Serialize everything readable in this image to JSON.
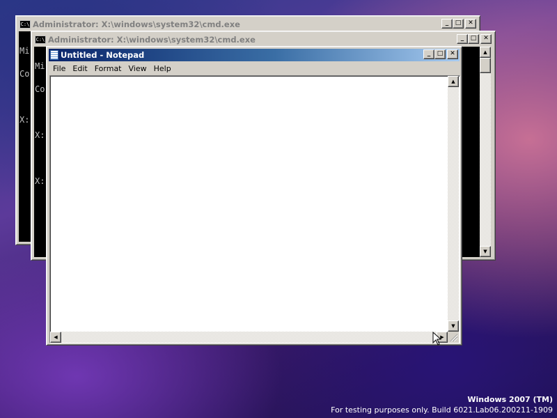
{
  "cmd_window_1": {
    "title": "Administrator: X:\\windows\\system32\\cmd.exe",
    "icon": "cmd-icon",
    "lines": [
      "Mi",
      "Co",
      "",
      "X:"
    ]
  },
  "cmd_window_2": {
    "title": "Administrator: X:\\windows\\system32\\cmd.exe",
    "icon": "cmd-icon",
    "lines": [
      "Mi",
      "Co",
      "",
      "X:",
      "",
      "X:"
    ]
  },
  "notepad": {
    "title": "Untitled - Notepad",
    "icon": "notepad-icon",
    "menu": [
      "File",
      "Edit",
      "Format",
      "View",
      "Help"
    ],
    "content": ""
  },
  "title_buttons": {
    "minimize": "_",
    "maximize": "□",
    "close": "✕"
  },
  "scroll_arrows": {
    "up": "▲",
    "down": "▼",
    "left": "◀",
    "right": "▶"
  },
  "watermark": {
    "title": "Windows 2007 (TM)",
    "build": "For testing purposes only. Build 6021.Lab06.200211-1909"
  }
}
